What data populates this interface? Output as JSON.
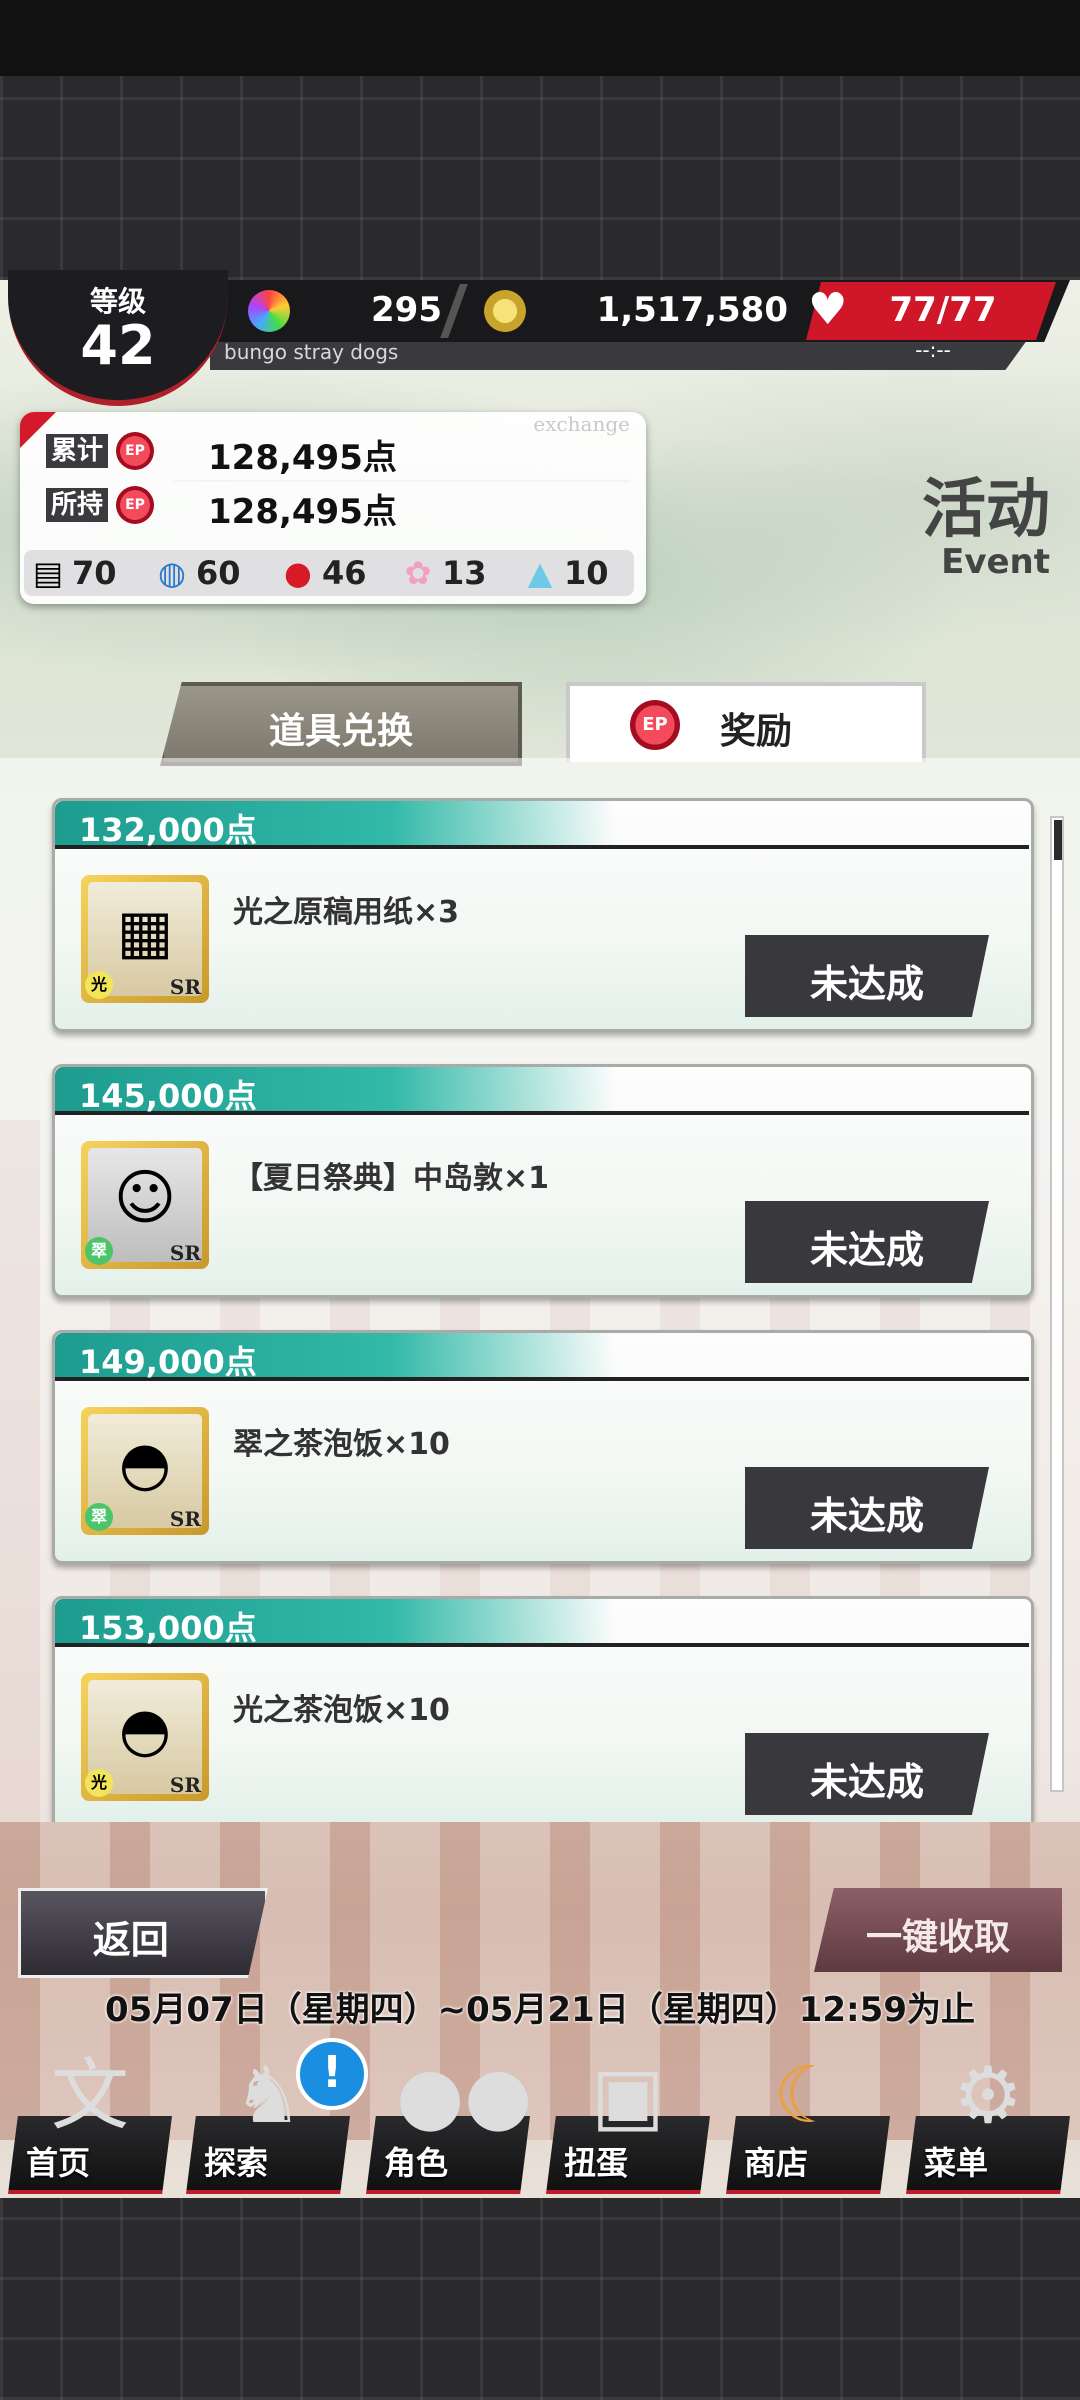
{
  "hud": {
    "level_label": "等级",
    "level_value": "42",
    "gems": "295",
    "coins": "1,517,580",
    "stamina": "77/77",
    "stamina_timer": "--:--",
    "subtitle": "bungo stray dogs"
  },
  "points": {
    "tag": "exchange",
    "ep": "EP",
    "total_label": "累计",
    "total_value": "128,495点",
    "held_label": "所持",
    "held_value": "128,495点",
    "items": [
      {
        "icon": "box-icon",
        "count": "70"
      },
      {
        "icon": "fan-icon",
        "count": "60"
      },
      {
        "icon": "candy-apple-icon",
        "count": "46"
      },
      {
        "icon": "pig-icon",
        "count": "13"
      },
      {
        "icon": "water-balloon-icon",
        "count": "10"
      }
    ]
  },
  "event": {
    "title": "活动",
    "subtitle": "Event"
  },
  "tabs": {
    "items_exchange": "道具兑换",
    "rewards": "奖励"
  },
  "rewards": [
    {
      "points": "132,000点",
      "name": "光之原稿用纸×3",
      "status": "未达成",
      "rarity": "SR",
      "attr": "光",
      "icon": "manuscript-paper-icon"
    },
    {
      "points": "145,000点",
      "name": "【夏日祭典】中岛敦×1",
      "status": "未达成",
      "rarity": "SR",
      "attr": "翠",
      "icon": "character-portrait-icon"
    },
    {
      "points": "149,000点",
      "name": "翠之茶泡饭×10",
      "status": "未达成",
      "rarity": "SR",
      "attr": "翠",
      "icon": "rice-bowl-icon"
    },
    {
      "points": "153,000点",
      "name": "光之茶泡饭×10",
      "status": "未达成",
      "rarity": "SR",
      "attr": "光",
      "icon": "rice-bowl-icon"
    }
  ],
  "actions": {
    "back": "返回",
    "collect_all": "一键收取",
    "period": "05月07日（星期四）~05月21日（星期四）12:59为止"
  },
  "nav": [
    {
      "label": "首页",
      "icon": "home-icon"
    },
    {
      "label": "探索",
      "icon": "explore-icon"
    },
    {
      "label": "角色",
      "icon": "characters-icon"
    },
    {
      "label": "扭蛋",
      "icon": "gacha-icon"
    },
    {
      "label": "商店",
      "icon": "shop-icon"
    },
    {
      "label": "菜单",
      "icon": "menu-gear-icon"
    }
  ],
  "alert_mark": "!"
}
